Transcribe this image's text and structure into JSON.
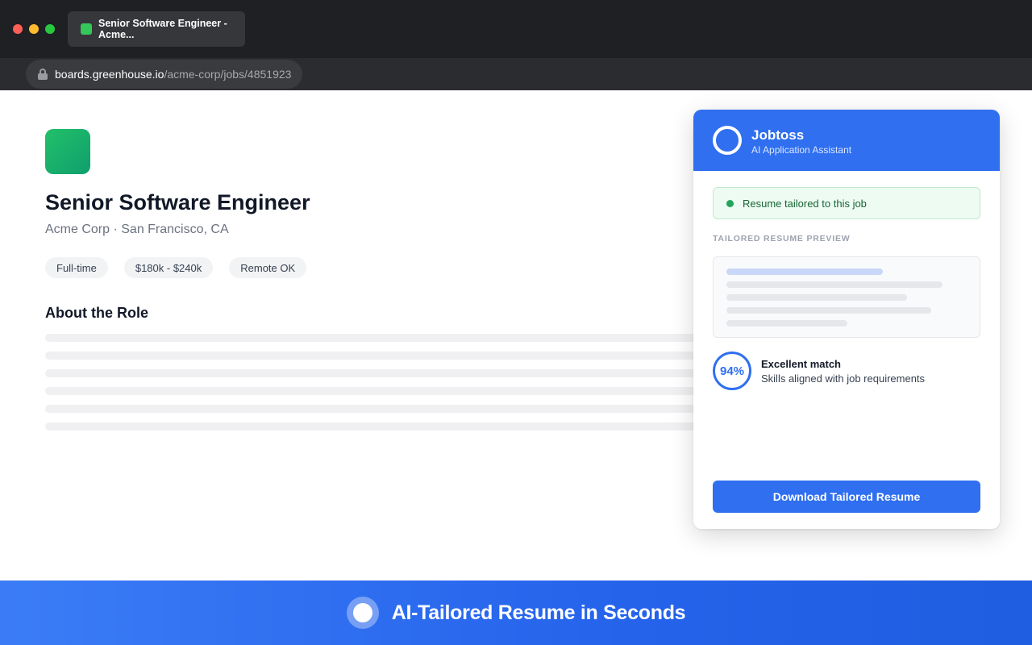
{
  "browser": {
    "tab_title": "Senior Software Engineer - Acme...",
    "url_host": "boards.greenhouse.io",
    "url_path": "/acme-corp/jobs/4851923"
  },
  "job": {
    "title": "Senior Software Engineer",
    "subtitle": "Acme Corp · San Francisco, CA",
    "tags": [
      "Full-time",
      "$180k - $240k",
      "Remote OK"
    ],
    "section_title": "About the Role"
  },
  "extension": {
    "name": "Jobtoss",
    "tagline": "AI Application Assistant",
    "status": "Resume tailored to this job",
    "preview_label": "TAILORED RESUME PREVIEW",
    "match_score": "94%",
    "match_title": "Excellent match",
    "match_desc": "Skills aligned with job requirements",
    "download_label": "Download Tailored Resume"
  },
  "banner": {
    "text": "AI-Tailored Resume in Seconds"
  },
  "colors": {
    "accent": "#2f6ff0",
    "success": "#22a55a",
    "company_logo": "#14b06b"
  }
}
